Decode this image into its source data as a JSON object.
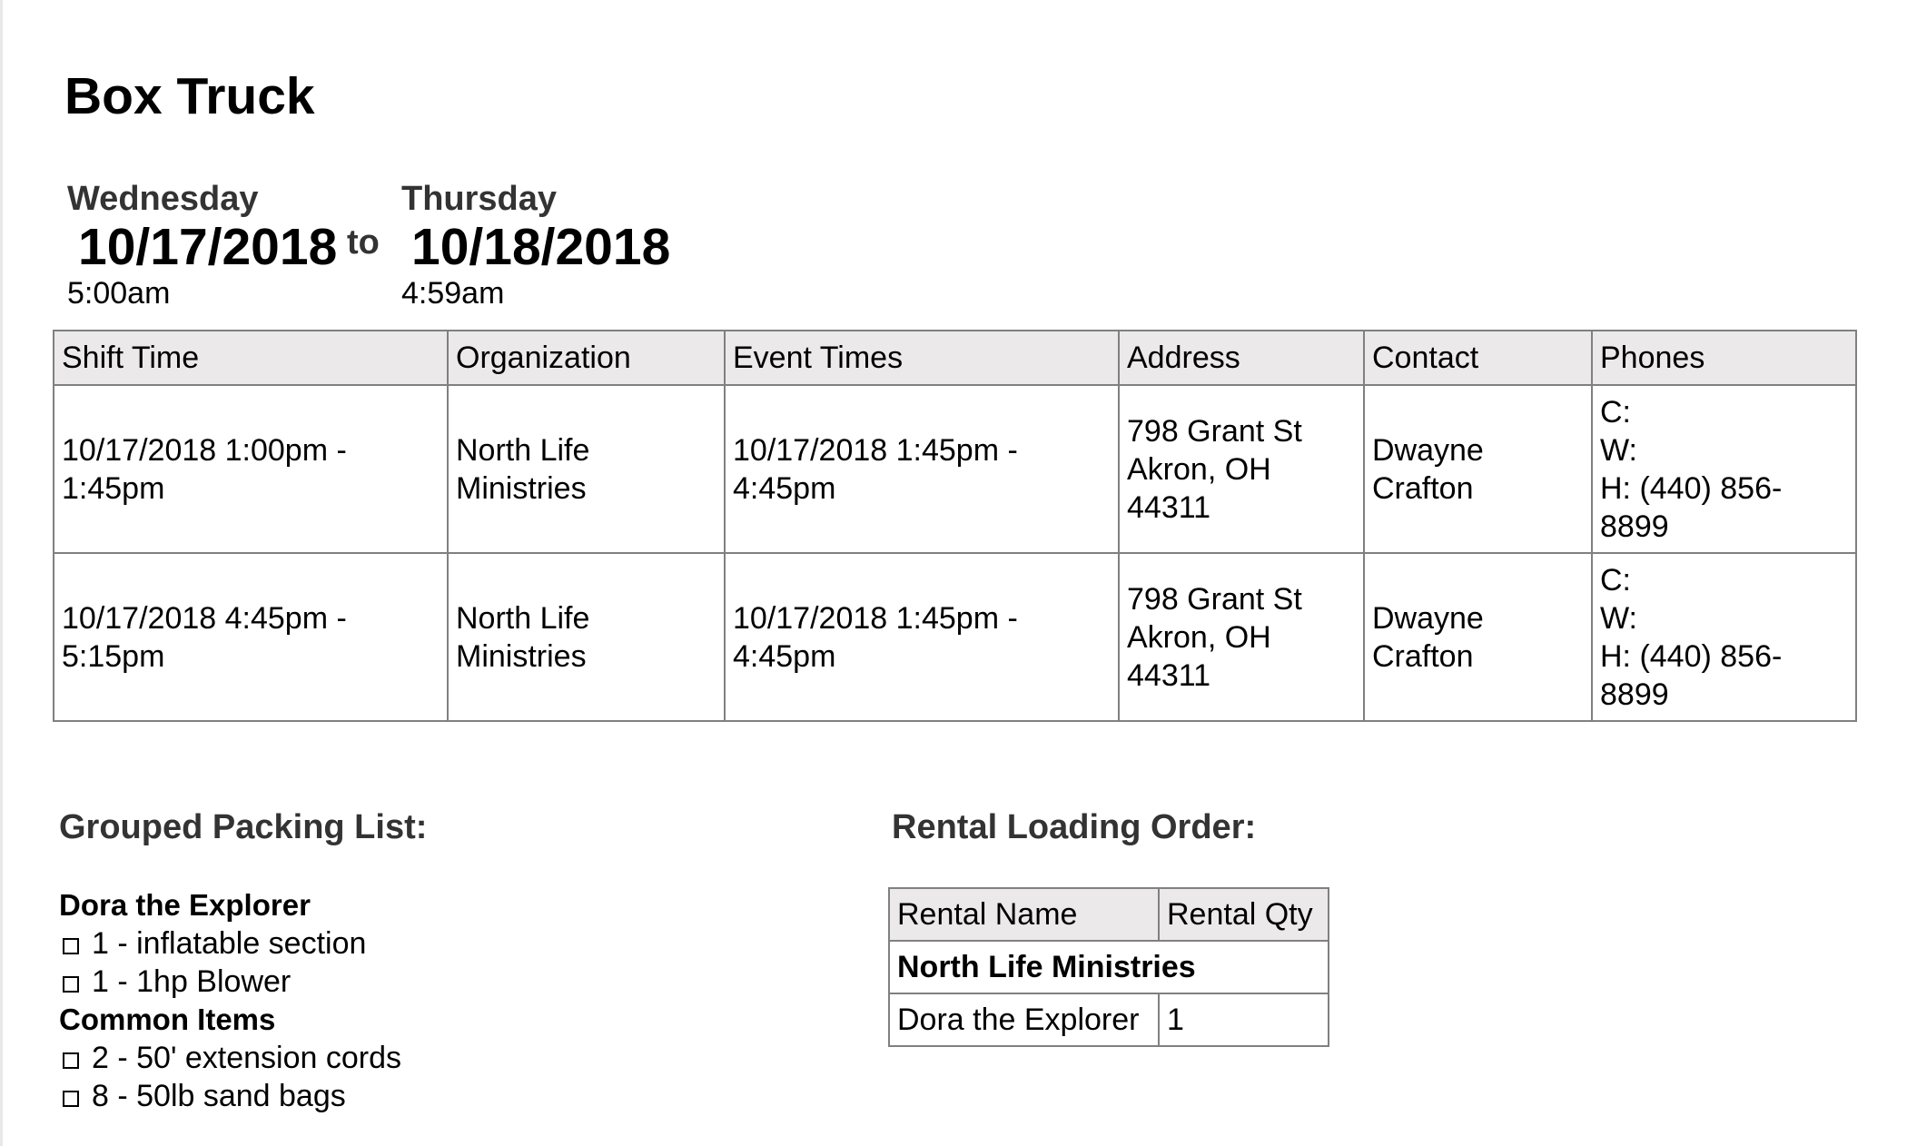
{
  "title": "Box Truck",
  "range": {
    "start": {
      "day": "Wednesday",
      "date": "10/17/2018",
      "time": "5:00am"
    },
    "separator": "to",
    "end": {
      "day": "Thursday",
      "date": "10/18/2018",
      "time": "4:59am"
    }
  },
  "shifts": {
    "headers": [
      "Shift Time",
      "Organization",
      "Event Times",
      "Address",
      "Contact",
      "Phones"
    ],
    "rows": [
      {
        "shift_time": [
          "10/17/2018 1:00pm -",
          "1:45pm"
        ],
        "organization": [
          "North Life",
          "Ministries"
        ],
        "event_times": [
          "10/17/2018 1:45pm -",
          "4:45pm"
        ],
        "address": [
          "798 Grant St",
          "Akron, OH",
          "44311"
        ],
        "contact": [
          "Dwayne",
          "Crafton"
        ],
        "phones": [
          "C:",
          "W:",
          "H: (440) 856-",
          "8899"
        ]
      },
      {
        "shift_time": [
          "10/17/2018 4:45pm -",
          "5:15pm"
        ],
        "organization": [
          "North Life",
          "Ministries"
        ],
        "event_times": [
          "10/17/2018 1:45pm -",
          "4:45pm"
        ],
        "address": [
          "798 Grant St",
          "Akron, OH",
          "44311"
        ],
        "contact": [
          "Dwayne",
          "Crafton"
        ],
        "phones": [
          "C:",
          "W:",
          "H: (440) 856-",
          "8899"
        ]
      }
    ]
  },
  "packing_list": {
    "heading": "Grouped Packing List:",
    "groups": [
      {
        "name": "Dora the Explorer",
        "items": [
          "1 - inflatable section",
          "1 - 1hp Blower"
        ]
      },
      {
        "name": "Common Items",
        "items": [
          "2 - 50' extension cords",
          "8 - 50lb sand bags"
        ]
      }
    ]
  },
  "rental_order": {
    "heading": "Rental Loading Order:",
    "headers": [
      "Rental Name",
      "Rental Qty"
    ],
    "groups": [
      {
        "name": "North Life Ministries",
        "rows": [
          {
            "name": "Dora the Explorer",
            "qty": "1"
          }
        ]
      }
    ]
  },
  "icons": {
    "checkbox": "empty-checkbox-icon"
  },
  "colors": {
    "header_bg": "#ece9ea",
    "border": "#808080",
    "subheading": "#333333",
    "text": "#000000"
  }
}
